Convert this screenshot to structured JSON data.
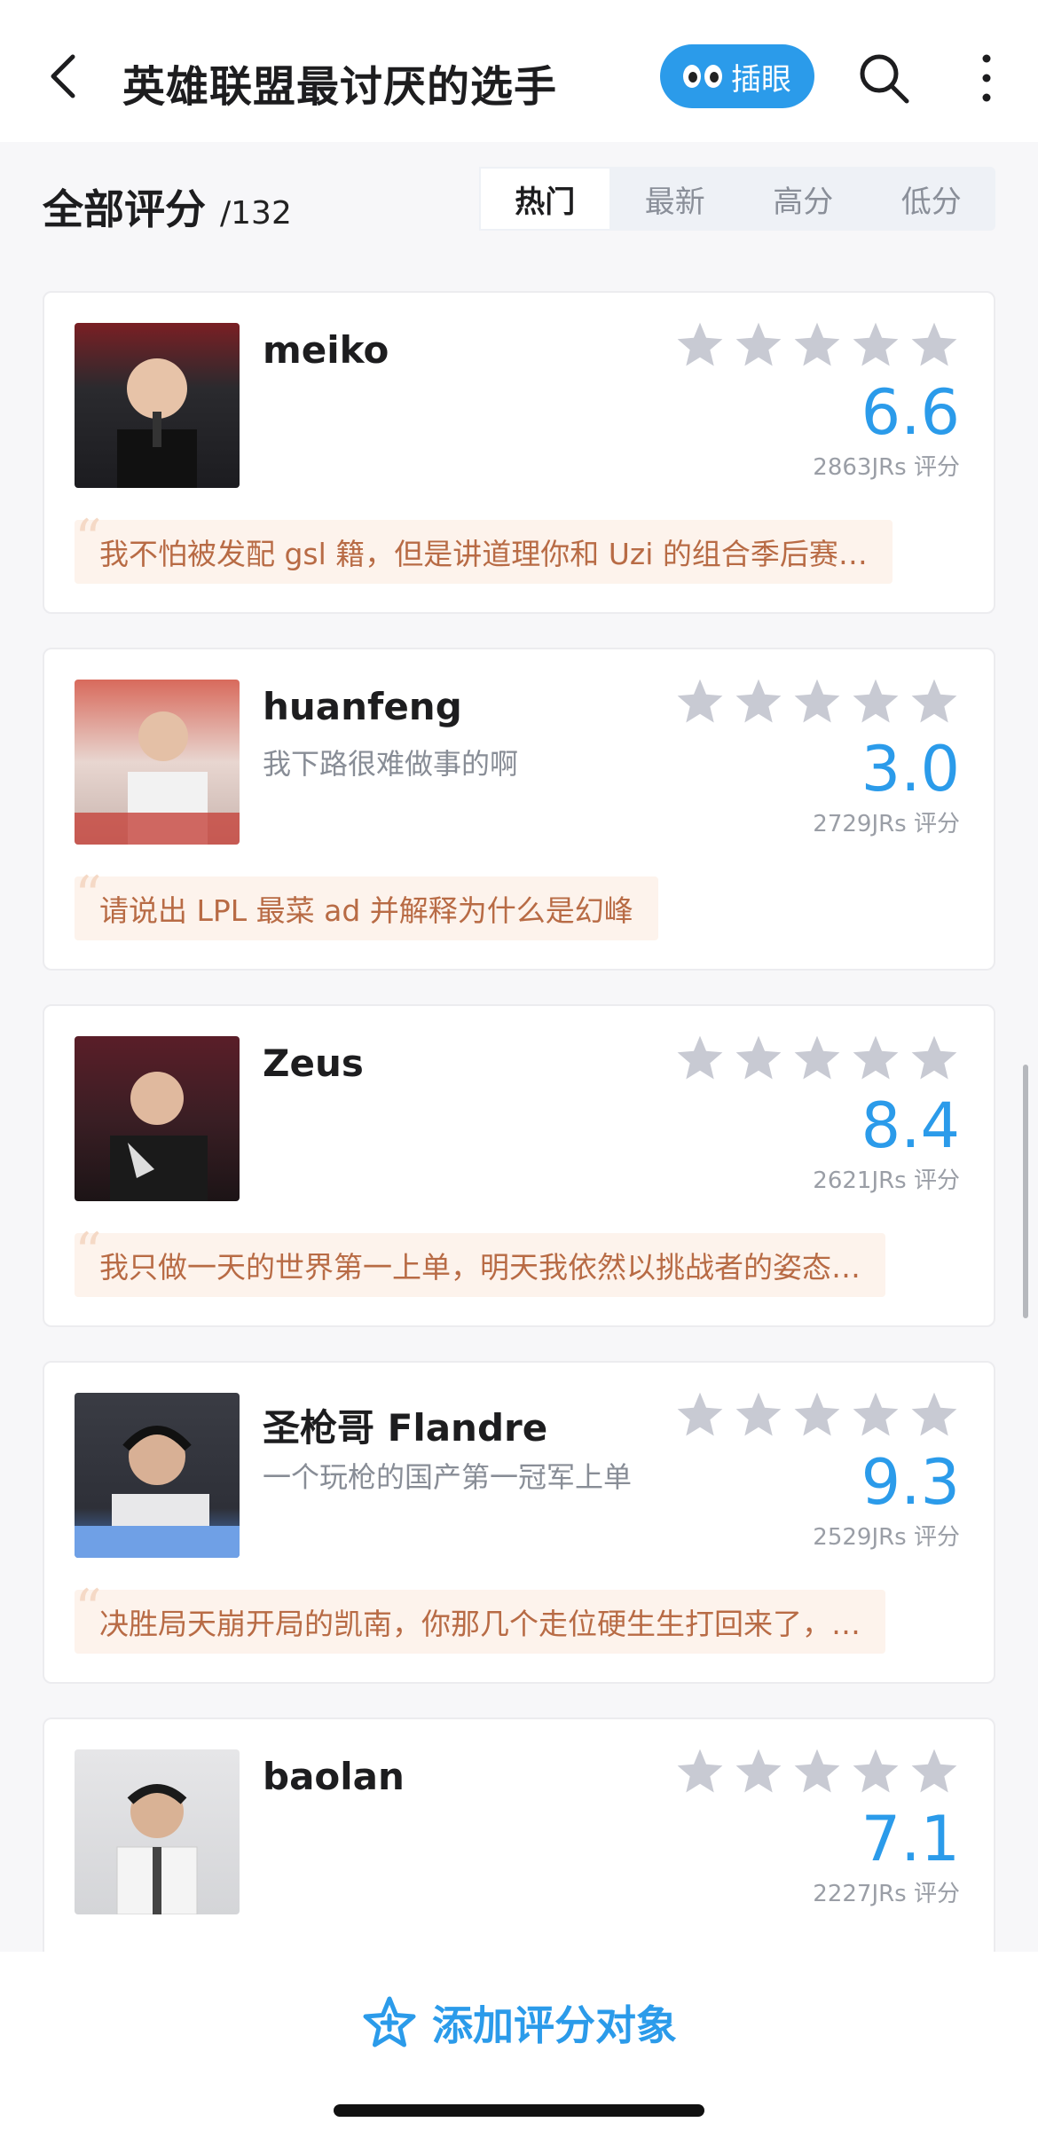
{
  "header": {
    "title": "英雄联盟最讨厌的选手",
    "peek_label": "插眼"
  },
  "filter": {
    "all_label": "全部评分",
    "count": "/132",
    "tabs": [
      "热门",
      "最新",
      "高分",
      "低分"
    ],
    "active_tab": "热门"
  },
  "items": [
    {
      "name": "meiko",
      "subtitle": "",
      "score": "6.6",
      "votes": "2863JRs 评分",
      "quote": "我不怕被发配 gsl 籍，但是讲道理你和 Uzi 的组合季后赛…",
      "avatar_color": "#2a2a2e"
    },
    {
      "name": "huanfeng",
      "subtitle": "我下路很难做事的啊",
      "score": "3.0",
      "votes": "2729JRs 评分",
      "quote": "请说出 LPL 最菜 ad 并解释为什么是幻峰",
      "avatar_color": "#c4a8a0"
    },
    {
      "name": "Zeus",
      "subtitle": "",
      "score": "8.4",
      "votes": "2621JRs 评分",
      "quote": "我只做一天的世界第一上单，明天我依然以挑战者的姿态…",
      "avatar_color": "#3a1e24"
    },
    {
      "name": "圣枪哥 Flandre",
      "subtitle": "一个玩枪的国产第一冠军上单",
      "score": "9.3",
      "votes": "2529JRs 评分",
      "quote": "决胜局天崩开局的凯南，你那几个走位硬生生打回来了，…",
      "avatar_color": "#2e3038"
    },
    {
      "name": "baolan",
      "subtitle": "",
      "score": "7.1",
      "votes": "2227JRs 评分",
      "quote": "",
      "avatar_color": "#d9dadc"
    }
  ],
  "bottom": {
    "add_label": "添加评分对象"
  },
  "colors": {
    "accent": "#2b9bea",
    "star_empty": "#c8cad3",
    "quote_bg": "#fdf3ec",
    "quote_text": "#b86b45"
  },
  "icons": {
    "back": "chevron-left-icon",
    "search": "search-icon",
    "more": "more-vertical-icon",
    "star": "star-icon",
    "add": "star-plus-icon"
  }
}
